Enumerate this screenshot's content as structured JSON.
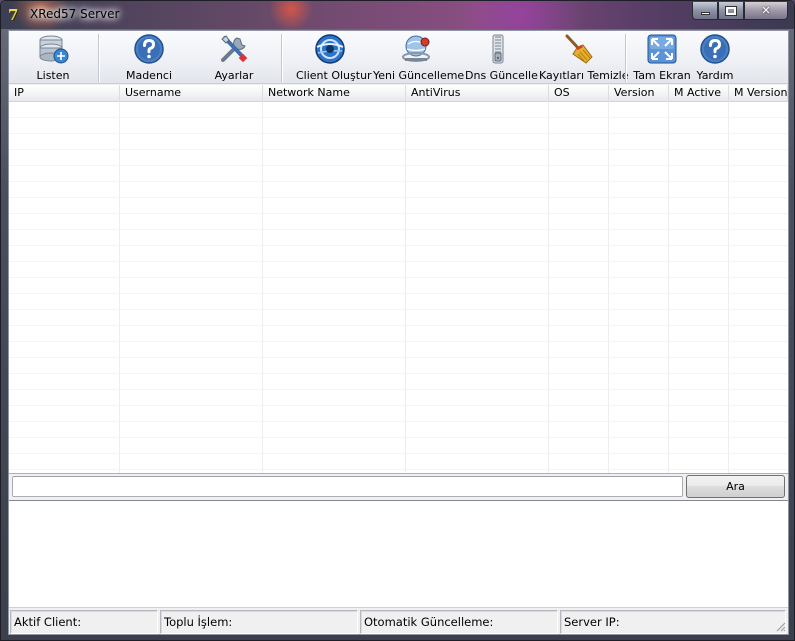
{
  "window": {
    "title": "XRed57 Server",
    "app_icon_glyph": "7",
    "controls": {
      "minimize": "minimize",
      "maximize": "maximize",
      "close": "✕"
    }
  },
  "toolbar": {
    "items": [
      {
        "label": "Listen",
        "icon": "server-listen-icon"
      },
      {
        "label": "Madenci",
        "icon": "help-icon"
      },
      {
        "label": "Ayarlar",
        "icon": "tools-icon"
      },
      {
        "label": "Client Oluştur",
        "icon": "globe-icon"
      },
      {
        "label": "Yeni Güncelleme",
        "icon": "network-update-icon"
      },
      {
        "label": "Dns Güncelle",
        "icon": "zipper-icon"
      },
      {
        "label": "Kayıtları Temizle",
        "icon": "broom-icon"
      },
      {
        "label": "Tam Ekran",
        "icon": "fullscreen-icon"
      },
      {
        "label": "Yardım",
        "icon": "help-icon"
      }
    ]
  },
  "clients_table": {
    "columns": [
      "IP",
      "Username",
      "Network Name",
      "AntiVirus",
      "OS",
      "Version",
      "M Active",
      "M Version"
    ],
    "rows": []
  },
  "search": {
    "value": "",
    "button_label": "Ara"
  },
  "log": {
    "text": ""
  },
  "status": {
    "active_client": "Aktif Client:",
    "bulk_operation": "Toplu İşlem:",
    "auto_update": "Otomatik Güncelleme:",
    "server_ip": "Server IP:"
  },
  "colors": {
    "accent_blue": "#2b74c9",
    "window_bg": "#f0f0f0",
    "title_text": "#000000"
  }
}
